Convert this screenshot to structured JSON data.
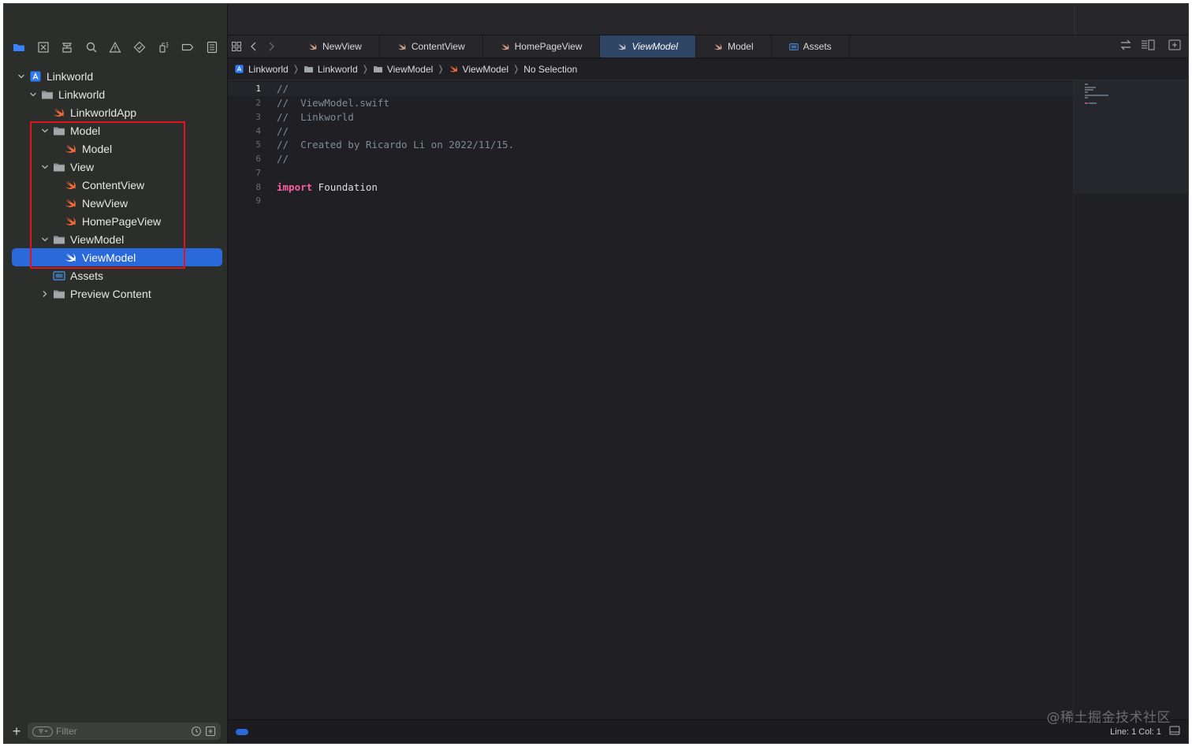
{
  "navigator": {
    "tree": [
      {
        "label": "Linkworld",
        "kind": "project",
        "indent": 0,
        "disclosure": "open"
      },
      {
        "label": "Linkworld",
        "kind": "folder",
        "indent": 1,
        "disclosure": "open"
      },
      {
        "label": "LinkworldApp",
        "kind": "swift",
        "indent": 2,
        "disclosure": "none"
      },
      {
        "label": "Model",
        "kind": "folder",
        "indent": 2,
        "disclosure": "open"
      },
      {
        "label": "Model",
        "kind": "swift",
        "indent": 3,
        "disclosure": "none"
      },
      {
        "label": "View",
        "kind": "folder",
        "indent": 2,
        "disclosure": "open"
      },
      {
        "label": "ContentView",
        "kind": "swift",
        "indent": 3,
        "disclosure": "none"
      },
      {
        "label": "NewView",
        "kind": "swift",
        "indent": 3,
        "disclosure": "none"
      },
      {
        "label": "HomePageView",
        "kind": "swift",
        "indent": 3,
        "disclosure": "none"
      },
      {
        "label": "ViewModel",
        "kind": "folder",
        "indent": 2,
        "disclosure": "open"
      },
      {
        "label": "ViewModel",
        "kind": "swift",
        "indent": 3,
        "disclosure": "none",
        "selected": true
      },
      {
        "label": "Assets",
        "kind": "assets",
        "indent": 2,
        "disclosure": "none"
      },
      {
        "label": "Preview Content",
        "kind": "folder",
        "indent": 2,
        "disclosure": "closed"
      }
    ],
    "filter_placeholder": "Filter"
  },
  "tabs": [
    {
      "label": "NewView",
      "icon": "swift",
      "active": false
    },
    {
      "label": "ContentView",
      "icon": "swift",
      "active": false
    },
    {
      "label": "HomePageView",
      "icon": "swift",
      "active": false
    },
    {
      "label": "ViewModel",
      "icon": "swift",
      "active": true
    },
    {
      "label": "Model",
      "icon": "swift",
      "active": false
    },
    {
      "label": "Assets",
      "icon": "assets",
      "active": false
    }
  ],
  "breadcrumb": [
    {
      "label": "Linkworld",
      "icon": "project"
    },
    {
      "label": "Linkworld",
      "icon": "folder"
    },
    {
      "label": "ViewModel",
      "icon": "folder"
    },
    {
      "label": "ViewModel",
      "icon": "swift"
    },
    {
      "label": "No Selection",
      "icon": "none"
    }
  ],
  "code_lines": [
    [
      {
        "t": "//",
        "c": "comment"
      }
    ],
    [
      {
        "t": "//  ViewModel.swift",
        "c": "comment"
      }
    ],
    [
      {
        "t": "//  Linkworld",
        "c": "comment"
      }
    ],
    [
      {
        "t": "//",
        "c": "comment"
      }
    ],
    [
      {
        "t": "//  Created by Ricardo Li on 2022/11/15.",
        "c": "comment"
      }
    ],
    [
      {
        "t": "//",
        "c": "comment"
      }
    ],
    [],
    [
      {
        "t": "import",
        "c": "keyword"
      },
      {
        "t": " Foundation",
        "c": "plain"
      }
    ],
    []
  ],
  "current_line": 1,
  "status": {
    "line_col": "Line: 1  Col: 1"
  },
  "watermark": "@稀土掘金技术社区",
  "colors": {
    "accent": "#2a69d9",
    "swift_icon": "#f26a38",
    "folder": "#8e9196",
    "highlight": "#e0141e",
    "keyword": "#fc5fa3",
    "comment": "#7f8c98"
  }
}
